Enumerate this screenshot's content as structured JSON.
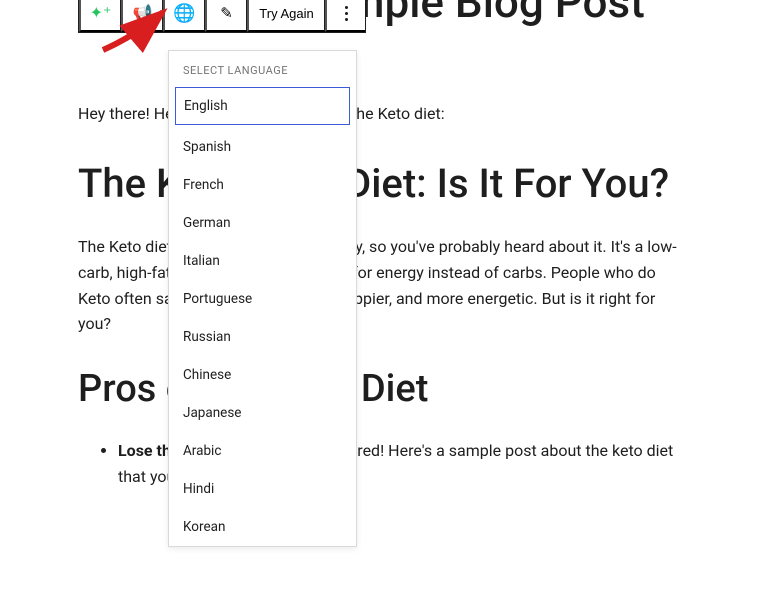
{
  "title": "This Is MY Sample Blog Post",
  "toolbar": {
    "try_again_label": "Try Again"
  },
  "intro_text": "Hey there! Here's a sample post about the Keto diet:",
  "heading_2": "The Ketogenic Diet: Is It For You?",
  "paragraph_1": "The Keto diet has become popular lately, so you've probably heard about it. It's a low-carb, high-fat diet all about burning fat for energy instead of carbs. People who do Keto often say they lose weight, feel happier, and more energetic. But is it right for you?",
  "heading_3": "Pros of the Keto Diet",
  "list_item_bold": "Lose th",
  "list_item_rest": "isHey there! I got you covered! Here's a sample post about the keto diet that you might wanna check out:",
  "dropdown": {
    "header": "SELECT LANGUAGE",
    "items": [
      "English",
      "Spanish",
      "French",
      "German",
      "Italian",
      "Portuguese",
      "Russian",
      "Chinese",
      "Japanese",
      "Arabic",
      "Hindi",
      "Korean"
    ]
  }
}
